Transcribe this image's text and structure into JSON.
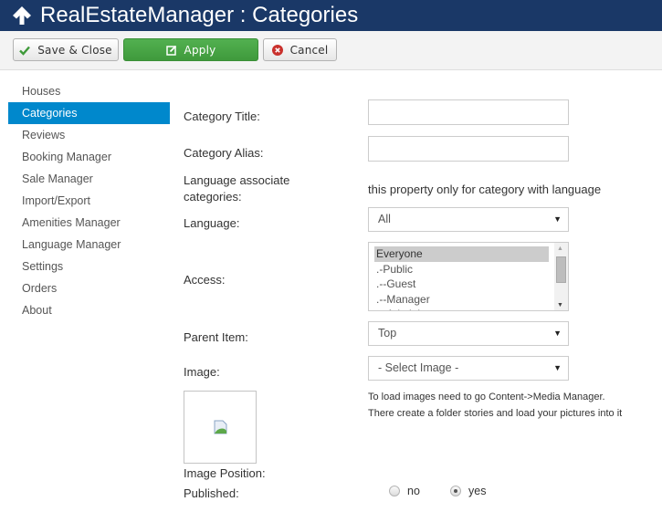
{
  "header": {
    "title": "RealEstateManager : Categories",
    "icon": "arrow-up-icon",
    "background_color": "#1a3867"
  },
  "toolbar": {
    "save_close_label": "Save & Close",
    "apply_label": "Apply",
    "cancel_label": "Cancel",
    "apply_color": "#4aa846"
  },
  "sidebar": {
    "active_color": "#0088cc",
    "items": [
      {
        "label": "Houses",
        "active": false
      },
      {
        "label": "Categories",
        "active": true
      },
      {
        "label": "Reviews",
        "active": false
      },
      {
        "label": "Booking Manager",
        "active": false
      },
      {
        "label": "Sale Manager",
        "active": false
      },
      {
        "label": "Import/Export",
        "active": false
      },
      {
        "label": "Amenities Manager",
        "active": false
      },
      {
        "label": "Language Manager",
        "active": false
      },
      {
        "label": "Settings",
        "active": false
      },
      {
        "label": "Orders",
        "active": false
      },
      {
        "label": "About",
        "active": false
      }
    ]
  },
  "form": {
    "category_title": {
      "label": "Category Title:",
      "value": ""
    },
    "category_alias": {
      "label": "Category Alias:",
      "value": ""
    },
    "language_associate": {
      "label_line1": "Language associate",
      "label_line2": "categories:",
      "note": "this property only for category with language"
    },
    "language": {
      "label": "Language:",
      "selected": "All"
    },
    "access": {
      "label": "Access:",
      "options": [
        "Everyone",
        ".-Public",
        ".--Guest",
        ".--Manager",
        ".--Administrator"
      ],
      "selected": "Everyone"
    },
    "parent_item": {
      "label": "Parent Item:",
      "selected": "Top"
    },
    "image": {
      "label": "Image:",
      "selected": "- Select Image -",
      "help_line1": "To load images need to go Content->Media Manager.",
      "help_line2": "There create a folder stories and load your pictures into it"
    },
    "image_position": {
      "label": "Image Position:"
    },
    "published": {
      "label": "Published:",
      "options": [
        {
          "label": "no",
          "checked": false
        },
        {
          "label": "yes",
          "checked": true
        }
      ]
    }
  }
}
